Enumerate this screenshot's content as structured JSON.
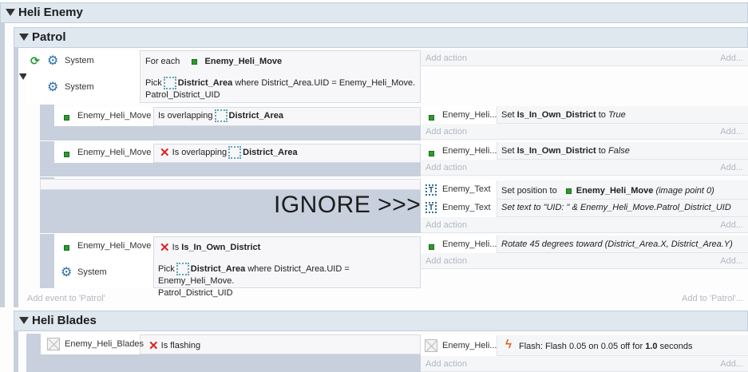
{
  "groups": {
    "heli_enemy": "Heli Enemy",
    "patrol": "Patrol",
    "heli_blades": "Heli Blades"
  },
  "common": {
    "add_action": "Add action",
    "add_ellipsis": "Add...",
    "add_event_patrol": "Add event to 'Patrol'",
    "add_to_patrol": "Add to 'Patrol'...",
    "ignore_label": "IGNORE >>>"
  },
  "event1": {
    "system": "System",
    "for_each": "For each",
    "obj": "Enemy_Heli_Move",
    "system2": "System",
    "pick": "Pick",
    "pick_obj": "District_Area",
    "pick_rest_line1": "where District_Area.UID = Enemy_Heli_Move.",
    "pick_rest_line2": "Patrol_District_UID"
  },
  "sub1": {
    "obj": "Enemy_Heli_Move",
    "cond": "Is overlapping",
    "cond_obj": "District_Area",
    "act_obj": "Enemy_Heli...",
    "act_pre": "Set",
    "act_var": "Is_In_Own_District",
    "act_to": "to",
    "act_val": "True"
  },
  "sub2": {
    "obj": "Enemy_Heli_Move",
    "cond": "Is overlapping",
    "cond_obj": "District_Area",
    "act_obj": "Enemy_Heli...",
    "act_pre": "Set",
    "act_var": "Is_In_Own_District",
    "act_to": "to",
    "act_val": "False"
  },
  "sub3": {
    "act1_obj": "Enemy_Text",
    "act1_pre": "Set position to",
    "act1_target": "Enemy_Heli_Move",
    "act1_rest": "(image point 0)",
    "act2_obj": "Enemy_Text",
    "act2_text": "Set text to \"UID: \" & Enemy_Heli_Move.Patrol_District_UID"
  },
  "sub4": {
    "obj": "Enemy_Heli_Move",
    "cond_pre": "Is",
    "cond_var": "Is_In_Own_District",
    "system": "System",
    "pick": "Pick",
    "pick_obj": "District_Area",
    "pick_rest_line1": "where District_Area.UID = Enemy_Heli_Move.",
    "pick_rest_line2": "Patrol_District_UID",
    "act_obj": "Enemy_Heli...",
    "act_text": "Rotate 45 degrees toward (District_Area.X, District_Area.Y)"
  },
  "blades": {
    "obj": "Enemy_Heli_Blades",
    "cond": "Is flashing",
    "act_obj": "Enemy_Heli...",
    "act_pre": "Flash: Flash 0.05 on 0.05 off for",
    "act_val": "1.0",
    "act_post": "seconds"
  },
  "icons": {
    "group_toggle": "collapse-triangle-icon",
    "system": "gear-icon",
    "loop": "loop-icon",
    "object": "sprite-dot-icon",
    "area": "district-area-icon",
    "invert": "invert-x-icon",
    "text_obj": "text-object-icon",
    "flash": "flash-bolt-icon"
  }
}
